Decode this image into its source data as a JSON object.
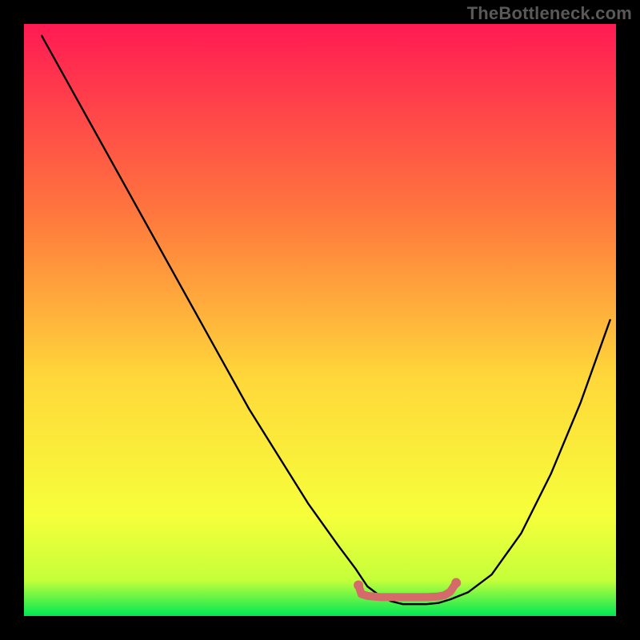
{
  "watermark": "TheBottleneck.com",
  "colors": {
    "frame": "#000000",
    "watermark_text": "#595959",
    "gradient_top": "#ff1a53",
    "gradient_mid1": "#ff7a3d",
    "gradient_mid2": "#ffd83a",
    "gradient_mid3": "#f6ff3a",
    "gradient_bottom": "#00e855",
    "curve": "#000000",
    "marker_fill": "#d46a6a",
    "marker_stroke": "#c85a5a"
  },
  "chart_data": {
    "type": "line",
    "title": "",
    "xlabel": "",
    "ylabel": "",
    "xlim": [
      0,
      100
    ],
    "ylim": [
      0,
      100
    ],
    "grid": false,
    "legend": false,
    "annotations": [],
    "series": [
      {
        "name": "bottleneck-curve",
        "x": [
          3,
          8,
          13,
          18,
          23,
          28,
          33,
          38,
          43,
          48,
          53,
          56,
          58,
          60,
          62,
          64,
          66,
          68,
          70,
          72,
          75,
          79,
          84,
          89,
          94,
          99
        ],
        "y": [
          98,
          89,
          80,
          71,
          62,
          53,
          44,
          35,
          27,
          19,
          12,
          8,
          5,
          3.5,
          2.5,
          2,
          2,
          2,
          2.2,
          2.8,
          4,
          7,
          14,
          24,
          36,
          50
        ]
      }
    ],
    "optimal_region": {
      "name": "optimal-marker",
      "x": [
        56.5,
        57,
        58,
        60,
        62,
        64,
        66,
        68,
        70,
        71,
        72,
        73
      ],
      "y": [
        5.2,
        3.7,
        3.4,
        3.2,
        3.2,
        3.2,
        3.2,
        3.2,
        3.3,
        3.5,
        4.1,
        5.6
      ]
    }
  }
}
